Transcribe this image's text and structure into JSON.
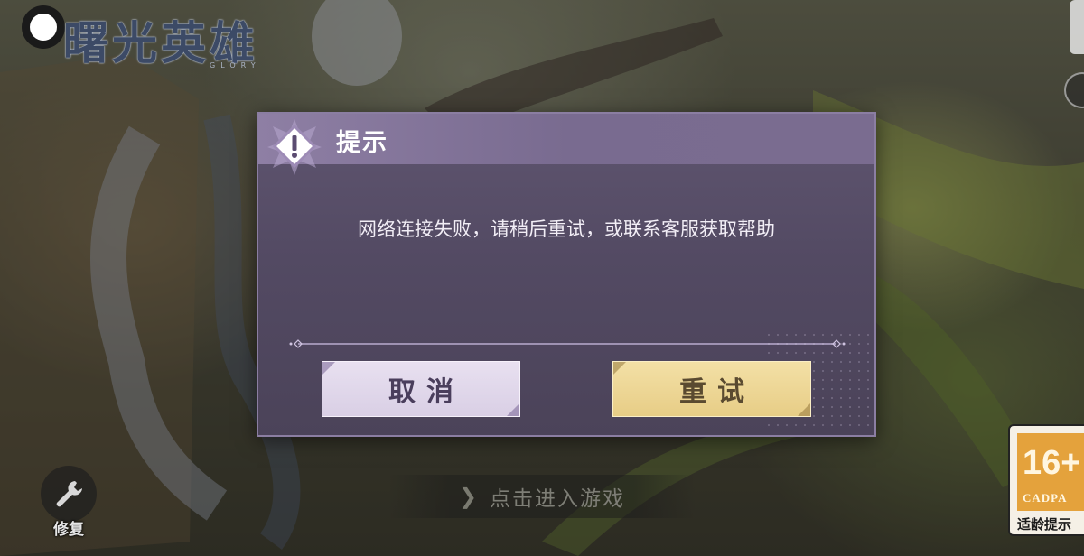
{
  "game": {
    "logo_text": "曙光英雄",
    "logo_subtitle": "GLORY",
    "enter_game_label": "点击进入游戏",
    "repair_label": "修复"
  },
  "dialog": {
    "title": "提示",
    "message": "网络连接失败，请稍后重试，或联系客服获取帮助",
    "cancel_label": "取消",
    "retry_label": "重试",
    "icon": "exclamation-diamond-icon"
  },
  "age_rating": {
    "age": "16+",
    "org": "CADPA",
    "caption": "适龄提示"
  },
  "icons": {
    "repair": "wrench-icon",
    "enter": "chevron-right-icon",
    "record": "record-dot-icon"
  },
  "colors": {
    "dialog_bg": "#534a63",
    "dialog_header": "#8e7fa4",
    "cancel_button": "#e8e0f0",
    "retry_button": "#f3e0a6",
    "age_badge": "#e4a23c"
  }
}
